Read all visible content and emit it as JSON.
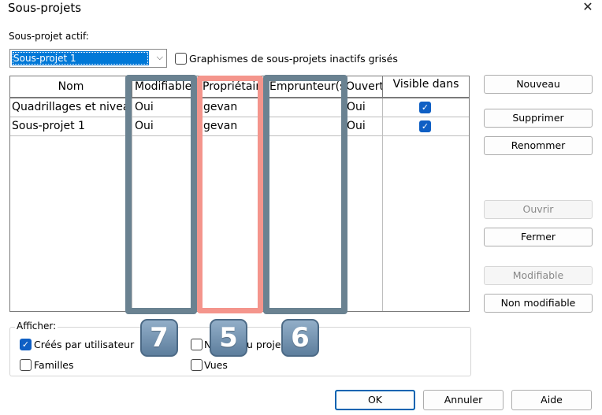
{
  "window": {
    "title": "Sous-projets",
    "close_glyph": "✕"
  },
  "active": {
    "label": "Sous-projet actif:",
    "value": "Sous-projet 1",
    "chevron": "⌵",
    "gray_inactive_label": "Graphismes de sous-projets inactifs grisés",
    "gray_inactive_checked": false
  },
  "grid": {
    "columns": [
      "Nom",
      "Modifiable",
      "Propriétair",
      "Emprunteur(s)",
      "Ouvert",
      "Visible dans"
    ],
    "rows": [
      {
        "name": "Quadrillages et niveaux",
        "editable": "Oui",
        "owner": "gevan",
        "borrowers": "",
        "open": "Oui",
        "visible": true
      },
      {
        "name": "Sous-projet 1",
        "editable": "Oui",
        "owner": "gevan",
        "borrowers": "",
        "open": "Oui",
        "visible": true
      }
    ]
  },
  "buttons": {
    "new": "Nouveau",
    "delete": "Supprimer",
    "rename": "Renommer",
    "open": "Ouvrir",
    "close": "Fermer",
    "editable": "Modifiable",
    "not_editable": "Non modifiable"
  },
  "filter": {
    "label": "Afficher:",
    "user_created": {
      "label": "Créés par utilisateur",
      "checked": true
    },
    "families": {
      "label": "Familles",
      "checked": false
    },
    "project_std_partial": "N",
    "project_std_tail": "u projet",
    "views": {
      "label": "Vues",
      "checked": false
    }
  },
  "annotations": {
    "badge_a": "7",
    "badge_b": "5",
    "badge_c": "6"
  },
  "footer": {
    "ok": "OK",
    "cancel": "Annuler",
    "help": "Aide"
  },
  "colors": {
    "accent": "#0078d7",
    "checkbox": "#0f5fc4",
    "frame_gray": "#6a8291",
    "frame_pink": "#f4958c"
  },
  "icons": {
    "check": "✓"
  }
}
